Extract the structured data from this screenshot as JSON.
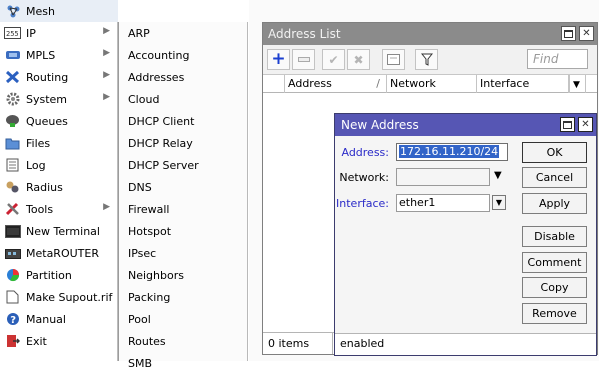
{
  "sidebar": {
    "items": [
      {
        "label": "Mesh",
        "icon": "mesh-icon",
        "arrow": false
      },
      {
        "label": "IP",
        "icon": "ip-icon",
        "arrow": true
      },
      {
        "label": "MPLS",
        "icon": "mpls-icon",
        "arrow": true
      },
      {
        "label": "Routing",
        "icon": "routing-icon",
        "arrow": true
      },
      {
        "label": "System",
        "icon": "system-gear-icon",
        "arrow": true
      },
      {
        "label": "Queues",
        "icon": "queues-icon",
        "arrow": false
      },
      {
        "label": "Files",
        "icon": "files-folder-icon",
        "arrow": false
      },
      {
        "label": "Log",
        "icon": "log-icon",
        "arrow": false
      },
      {
        "label": "Radius",
        "icon": "radius-icon",
        "arrow": false
      },
      {
        "label": "Tools",
        "icon": "tools-icon",
        "arrow": true
      },
      {
        "label": "New Terminal",
        "icon": "terminal-icon",
        "arrow": false
      },
      {
        "label": "MetaROUTER",
        "icon": "metarouter-icon",
        "arrow": false
      },
      {
        "label": "Partition",
        "icon": "partition-pie-icon",
        "arrow": false
      },
      {
        "label": "Make Supout.rif",
        "icon": "supout-file-icon",
        "arrow": false
      },
      {
        "label": "Manual",
        "icon": "manual-help-icon",
        "arrow": false
      },
      {
        "label": "Exit",
        "icon": "exit-icon",
        "arrow": false
      }
    ]
  },
  "submenu": {
    "items": [
      "ARP",
      "Accounting",
      "Addresses",
      "Cloud",
      "DHCP Client",
      "DHCP Relay",
      "DHCP Server",
      "DNS",
      "Firewall",
      "Hotspot",
      "IPsec",
      "Neighbors",
      "Packing",
      "Pool",
      "Routes",
      "SMB"
    ]
  },
  "address_list": {
    "title": "Address List",
    "find_placeholder": "Find",
    "columns": [
      "Address",
      "Network",
      "Interface"
    ],
    "items_count": "0 items",
    "toolbar_icons": [
      "add-plus-icon",
      "remove-minus-icon",
      "enable-check-icon",
      "disable-x-icon",
      "comment-note-icon",
      "filter-funnel-icon"
    ]
  },
  "dialog": {
    "title": "New Address",
    "labels": {
      "address": "Address:",
      "network": "Network:",
      "interface": "Interface:"
    },
    "values": {
      "address": "172.16.11.210/24",
      "network": "",
      "interface": "ether1"
    },
    "buttons": [
      "OK",
      "Cancel",
      "Apply",
      "Disable",
      "Comment",
      "Copy",
      "Remove"
    ],
    "status": "enabled"
  },
  "colors": {
    "dialog_title": "#5656b4",
    "inactive_title": "#8b8b8b",
    "selected_menu": "#cfe0f6",
    "required_label": "#2a2ac8"
  }
}
